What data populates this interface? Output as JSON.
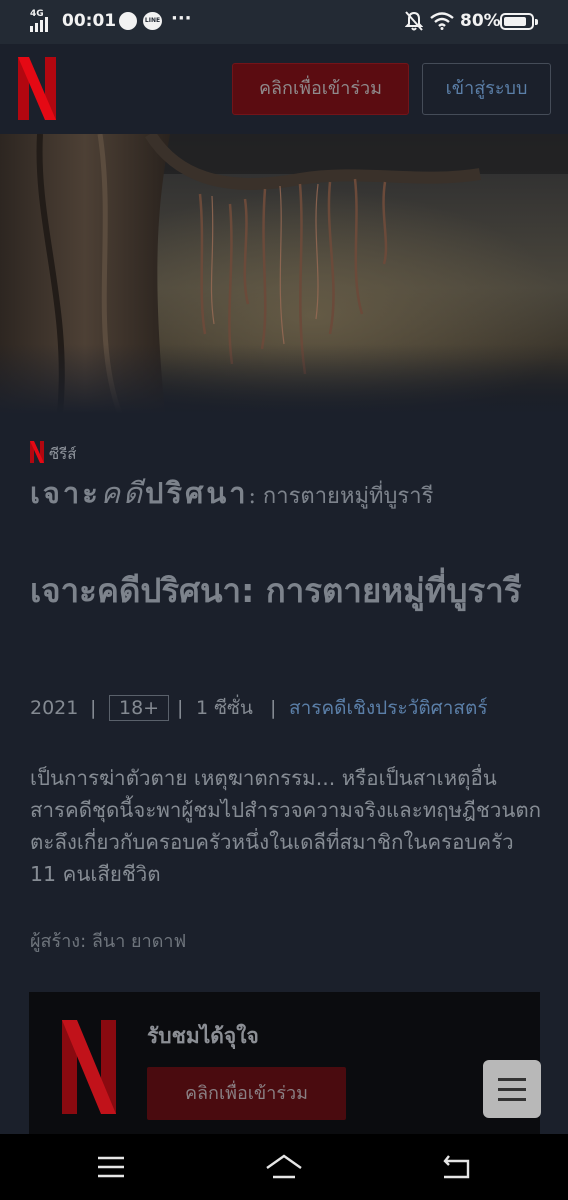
{
  "status_bar": {
    "network": "4G",
    "time": "00:01",
    "line_badge": "LINE",
    "more": "···",
    "battery": "80%"
  },
  "header": {
    "join_button": "คลิกเพื่อเข้าร่วม",
    "login_button": "เข้าสู่ระบบ"
  },
  "show": {
    "type_label": "ซีรีส์",
    "logo_parts": [
      "เจาะ",
      "คดี",
      "ปริศนา",
      ": การตายหมู่ที่บูรารี"
    ],
    "title": "เจาะคดีปริศนา: การตายหมู่ที่บูรารี",
    "year": "2021",
    "rating": "18+",
    "seasons": "1 ซีซั่น",
    "genre": "สารคดีเชิงประวัติศาสตร์",
    "separator": "|",
    "description": "เป็นการฆ่าตัวตาย เหตุฆาตกรรม... หรือเป็นสาเหตุอื่น สารคดีชุดนี้จะพาผู้ชมไปสำรวจความจริงและทฤษฎีชวนตกตะลึงเกี่ยวกับครอบครัวหนึ่งในเดลีที่สมาชิกในครอบครัว 11 คนเสียชีวิต",
    "creator": "ผู้สร้าง: ลีนา ยาดาฟ"
  },
  "promo_card": {
    "title": "รับชมได้จุใจ",
    "button": "คลิกเพื่อเข้าร่วม"
  },
  "colors": {
    "brand_red": "#e50914",
    "background": "#1b202b",
    "link_blue": "#5b7fa8"
  }
}
